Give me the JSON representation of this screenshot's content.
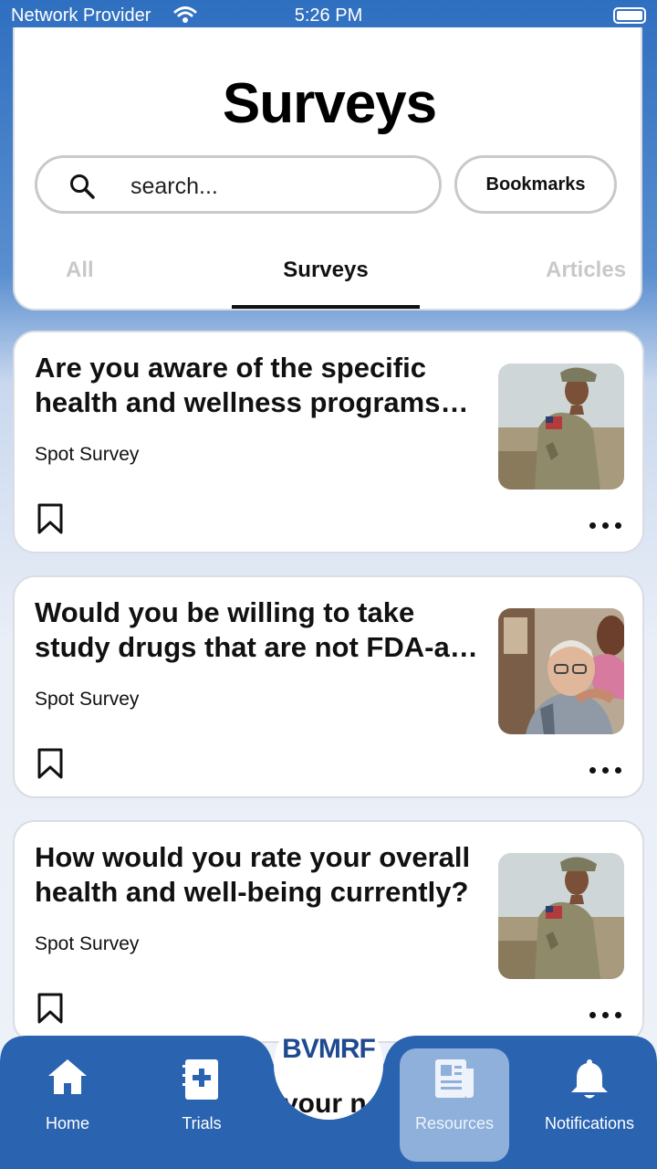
{
  "status": {
    "carrier": "Network Provider",
    "time": "5:26 PM"
  },
  "header": {
    "title": "Surveys",
    "search_placeholder": "search...",
    "bookmarks_label": "Bookmarks",
    "tabs": [
      {
        "label": "All",
        "active": false
      },
      {
        "label": "Surveys",
        "active": true
      },
      {
        "label": "Articles",
        "active": false
      }
    ]
  },
  "cards": [
    {
      "title": "Are you aware of the specific health and wellness programs…",
      "type": "Spot Survey",
      "image": "soldier-photo"
    },
    {
      "title": "Would you be willing to take study drugs that are not FDA-a…",
      "type": "Spot Survey",
      "image": "elderly-man-photo"
    },
    {
      "title": "How would you rate your overall health and well-being currently?",
      "type": "Spot Survey",
      "image": "soldier-photo"
    }
  ],
  "nav": {
    "home": "Home",
    "trials": "Trials",
    "logo": "BVMRF",
    "logo_peek": "your n",
    "resources": "Resources",
    "notifications": "Notifications",
    "active": "resources"
  },
  "colors": {
    "nav_blue": "#2a63b0",
    "active_tab_bg": "#8eb0db"
  }
}
